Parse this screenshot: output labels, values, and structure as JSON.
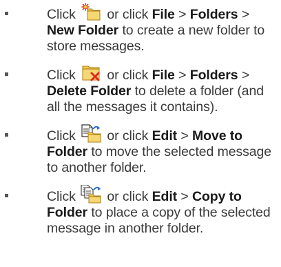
{
  "items": [
    {
      "icon": "new-folder-icon",
      "click": "Click",
      "mid": "or click",
      "path": [
        "File",
        "Folders",
        "New Folder"
      ],
      "sep": ">",
      "desc": "to create a new folder to store messages."
    },
    {
      "icon": "delete-folder-icon",
      "click": "Click",
      "mid": "or click",
      "path": [
        "File",
        "Folders",
        "Delete Folder"
      ],
      "sep": ">",
      "desc": "to delete a folder (and all the messages it contains)."
    },
    {
      "icon": "move-to-folder-icon",
      "click": "Click",
      "mid": "or click",
      "path": [
        "Edit",
        "Move to Folder"
      ],
      "sep": ">",
      "desc": "to move the selected message to another folder."
    },
    {
      "icon": "copy-to-folder-icon",
      "click": "Click",
      "mid": "or click",
      "path": [
        "Edit",
        "Copy to Folder"
      ],
      "sep": ">",
      "desc": "to place a copy of the selected message in another folder."
    }
  ],
  "colors": {
    "text": "#3a3a3a",
    "bold": "#1a1a1a",
    "folder": "#f2c94c",
    "folder_dark": "#c99a1c",
    "red": "#e02a20",
    "blue": "#2a6fc9"
  }
}
